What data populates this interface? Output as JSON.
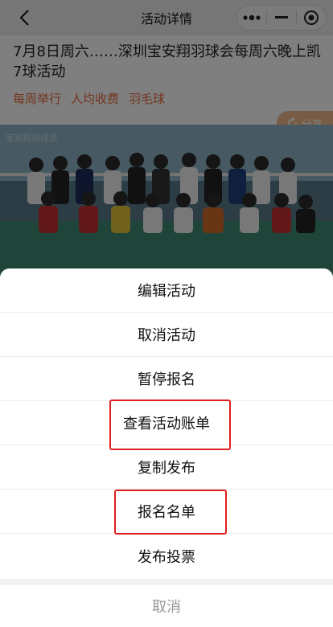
{
  "navbar": {
    "title": "活动详情",
    "back_icon": "chevron-left-icon",
    "capsule_icons": [
      "more-dots-icon",
      "minimize-icon",
      "close-target-icon"
    ]
  },
  "event": {
    "title": "7月8日周六……深圳宝安翔羽球会每周六晚上凯7球活动",
    "tags": [
      "每周举行",
      "人均收费",
      "羽毛球"
    ],
    "share_label": "分享",
    "photo_watermark": "宝安翔羽球会"
  },
  "action_sheet": {
    "items": [
      "编辑活动",
      "取消活动",
      "暂停报名",
      "查看活动账单",
      "复制发布",
      "报名名单",
      "发布投票"
    ],
    "cancel_label": "取消",
    "highlighted": [
      "查看活动账单",
      "报名名单"
    ],
    "highlight_color": "#e02020"
  },
  "colors": {
    "accent_tag": "#e8683a",
    "share_bg": "#f0b98a"
  }
}
